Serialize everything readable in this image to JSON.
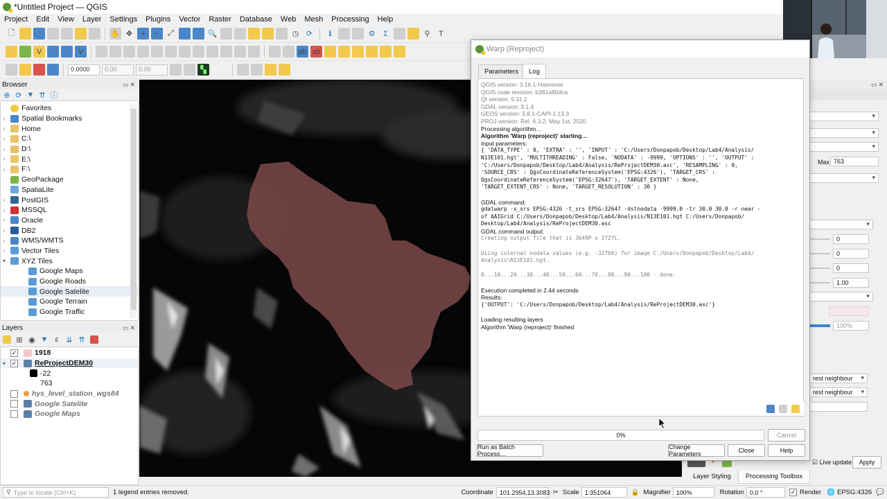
{
  "window": {
    "title": "*Untitled Project — QGIS"
  },
  "menu": [
    "Project",
    "Edit",
    "View",
    "Layer",
    "Settings",
    "Plugins",
    "Vector",
    "Raster",
    "Database",
    "Web",
    "Mesh",
    "Processing",
    "Help"
  ],
  "digitize_toolbar": {
    "val1": "0.0000",
    "val2": "0.00",
    "val3": "0.00"
  },
  "browser": {
    "title": "Browser",
    "items": [
      {
        "label": "Favorites",
        "icon": "star-icon",
        "color": "#f2c94c"
      },
      {
        "label": "Spatial Bookmarks",
        "icon": "bookmark-icon",
        "color": "#4a86c8"
      },
      {
        "label": "Home",
        "icon": "folder-icon",
        "color": "#e8c36a"
      },
      {
        "label": "C:\\",
        "icon": "folder-icon",
        "color": "#e8c36a"
      },
      {
        "label": "D:\\",
        "icon": "folder-icon",
        "color": "#e8c36a"
      },
      {
        "label": "E:\\",
        "icon": "folder-icon",
        "color": "#e8c36a"
      },
      {
        "label": "F:\\",
        "icon": "folder-icon",
        "color": "#e8c36a"
      },
      {
        "label": "GeoPackage",
        "icon": "geopackage-icon",
        "color": "#7ab648"
      },
      {
        "label": "SpatiaLite",
        "icon": "spatialite-icon",
        "color": "#6fa8dc"
      },
      {
        "label": "PostGIS",
        "icon": "postgis-icon",
        "color": "#336791"
      },
      {
        "label": "MSSQL",
        "icon": "mssql-icon",
        "color": "#cc3333"
      },
      {
        "label": "Oracle",
        "icon": "oracle-icon",
        "color": "#4a86c8"
      },
      {
        "label": "DB2",
        "icon": "db2-icon",
        "color": "#2a5b9b"
      },
      {
        "label": "WMS/WMTS",
        "icon": "wms-icon",
        "color": "#4a86c8"
      },
      {
        "label": "Vector Tiles",
        "icon": "vector-tiles-icon",
        "color": "#5b9bd5"
      },
      {
        "label": "XYZ Tiles",
        "icon": "xyz-tiles-icon",
        "color": "#5b9bd5"
      },
      {
        "label": "Google Maps",
        "icon": "grid-icon",
        "color": "#5b9bd5"
      },
      {
        "label": "Google Roads",
        "icon": "grid-icon",
        "color": "#5b9bd5"
      },
      {
        "label": "Google Satelite",
        "icon": "grid-icon",
        "color": "#5b9bd5"
      },
      {
        "label": "Google Terrain",
        "icon": "grid-icon",
        "color": "#5b9bd5"
      },
      {
        "label": "Google Traffic",
        "icon": "grid-icon",
        "color": "#5b9bd5"
      }
    ]
  },
  "layers": {
    "title": "Layers",
    "items": [
      {
        "label": "1918",
        "checked": true,
        "swatch": "#f4c8cc"
      },
      {
        "label": "ReProjectDEM30",
        "checked": true
      },
      {
        "label": "-22"
      },
      {
        "label": "763"
      },
      {
        "label": "hys_level_station_wgs84",
        "checked": false
      },
      {
        "label": "Google Satelite",
        "checked": false
      },
      {
        "label": "Google Maps",
        "checked": false
      }
    ]
  },
  "dialog": {
    "title": "Warp (Reproject)",
    "tabs": [
      "Parameters",
      "Log"
    ],
    "log": [
      {
        "t": "QGIS version: 3.16.1-Hannover",
        "c": "gray"
      },
      {
        "t": "QGIS code revision: b381a90dca",
        "c": "gray"
      },
      {
        "t": "Qt version: 5.11.2",
        "c": "gray"
      },
      {
        "t": "GDAL version: 3.1.4",
        "c": "gray"
      },
      {
        "t": "GEOS version: 3.8.1-CAPI-1.13.3",
        "c": "gray"
      },
      {
        "t": "PROJ version: Rel. 6.3.2, May 1st, 2020",
        "c": "gray"
      },
      {
        "t": "Processing algorithm…",
        "c": ""
      },
      {
        "t": "Algorithm 'Warp (reproject)' starting…",
        "c": "bold"
      },
      {
        "t": "Input parameters:",
        "c": ""
      },
      {
        "t": "{ 'DATA_TYPE' : 0, 'EXTRA' : '', 'INPUT' : 'C:/Users/Donpapob/Desktop/Lab4/Analysis/",
        "c": "mono"
      },
      {
        "t": "N13E101.hgt', 'MULTITHREADING' : False, 'NODATA' : -9999, 'OPTIONS' : '', 'OUTPUT' :",
        "c": "mono"
      },
      {
        "t": "'C:/Users/Donpapob/Desktop/Lab4/Analysis/ReProjectDEM30.asc', 'RESAMPLING' : 0,",
        "c": "mono"
      },
      {
        "t": "'SOURCE_CRS' : QgsCoordinateReferenceSystem('EPSG:4326'), 'TARGET_CRS' :",
        "c": "mono"
      },
      {
        "t": "QgsCoordinateReferenceSystem('EPSG:32647'), 'TARGET_EXTENT' : None,",
        "c": "mono"
      },
      {
        "t": "'TARGET_EXTENT_CRS' : None, 'TARGET_RESOLUTION' : 30 }",
        "c": "mono"
      },
      {
        "t": " ",
        "c": ""
      },
      {
        "t": "GDAL command:",
        "c": ""
      },
      {
        "t": "gdalwarp -s_srs EPSG:4326 -t_srs EPSG:32647 -dstnodata -9999.0 -tr 30.0 30.0 -r near -",
        "c": "mono"
      },
      {
        "t": "of AAIGrid C:/Users/Donpapob/Desktop/Lab4/Analysis/N13E101.hgt C:/Users/Donpapob/",
        "c": "mono"
      },
      {
        "t": "Desktop/Lab4/Analysis/ReProjectDEM30.asc",
        "c": "mono"
      },
      {
        "t": "GDAL command output:",
        "c": ""
      },
      {
        "t": "Creating output file that is 3649P x 3727L.",
        "c": "mono gray"
      },
      {
        "t": " ",
        "c": ""
      },
      {
        "t": "Using internal nodata values (e.g. -32768) for image C:/Users/Donpapob/Desktop/Lab4/",
        "c": "mono gray"
      },
      {
        "t": "Analysis\\N13E101.hgt.",
        "c": "mono gray"
      },
      {
        "t": " ",
        "c": ""
      },
      {
        "t": "0...10...20...30...40...50...60...70...80...90...100 - done.",
        "c": "mono gray"
      },
      {
        "t": " ",
        "c": ""
      },
      {
        "t": "Execution completed in 2.44 seconds",
        "c": ""
      },
      {
        "t": "Results:",
        "c": ""
      },
      {
        "t": "{'OUTPUT': 'C:/Users/Donpapob/Desktop/Lab4/Analysis/ReProjectDEM30.asc'}",
        "c": "mono"
      },
      {
        "t": " ",
        "c": ""
      },
      {
        "t": "Loading resulting layers",
        "c": ""
      },
      {
        "t": "Algorithm 'Warp (reproject)' finished",
        "c": ""
      }
    ],
    "progress_label": "0%",
    "progress": 0,
    "buttons": {
      "cancel": "Cancel",
      "batch": "Run as Batch Process…",
      "change": "Change Parameters",
      "close": "Close",
      "help": "Help"
    }
  },
  "right_panel": {
    "max_label": "Max",
    "max_value": "763",
    "spin_values": [
      "0",
      "0",
      "0",
      "1.00"
    ],
    "opacity": "100%",
    "resample1": "rest neighbour",
    "resample2": "rest neighbour",
    "live_update": "Live update",
    "apply": "Apply",
    "tabs": [
      "Layer Styling",
      "Processing Toolbox"
    ]
  },
  "status": {
    "locate_placeholder": "Type to locate (Ctrl+K)",
    "message": "1 legend entries removed.",
    "coordinate_label": "Coordinate",
    "coordinate": "101.2954,13.3083",
    "scale_label": "Scale",
    "scale": "1:351064",
    "magnifier_label": "Magnifier",
    "magnifier": "100%",
    "rotation_label": "Rotation",
    "rotation": "0.0 °",
    "render_label": "Render",
    "crs": "EPSG:4326"
  }
}
